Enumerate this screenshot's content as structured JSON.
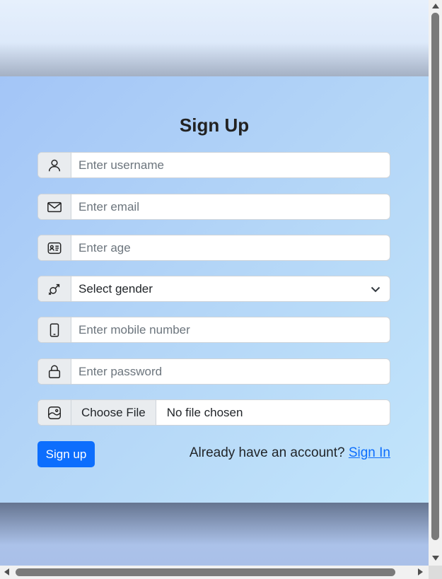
{
  "form": {
    "title": "Sign Up",
    "username": {
      "placeholder": "Enter username",
      "icon": "user-icon"
    },
    "email": {
      "placeholder": "Enter email",
      "icon": "envelope-icon"
    },
    "age": {
      "placeholder": "Enter age",
      "icon": "id-card-icon"
    },
    "gender": {
      "selected": "Select gender",
      "icon": "gender-icon"
    },
    "mobile": {
      "placeholder": "Enter mobile number",
      "icon": "phone-icon"
    },
    "password": {
      "placeholder": "Enter password",
      "icon": "lock-icon"
    },
    "file": {
      "button_label": "Choose File",
      "status": "No file chosen",
      "icon": "image-icon"
    },
    "submit_label": "Sign up",
    "signin_prompt": "Already have an account?",
    "signin_link": "Sign In"
  },
  "colors": {
    "primary": "#0d6efd",
    "addon_bg": "#e9ecef",
    "border": "#ced4da"
  }
}
